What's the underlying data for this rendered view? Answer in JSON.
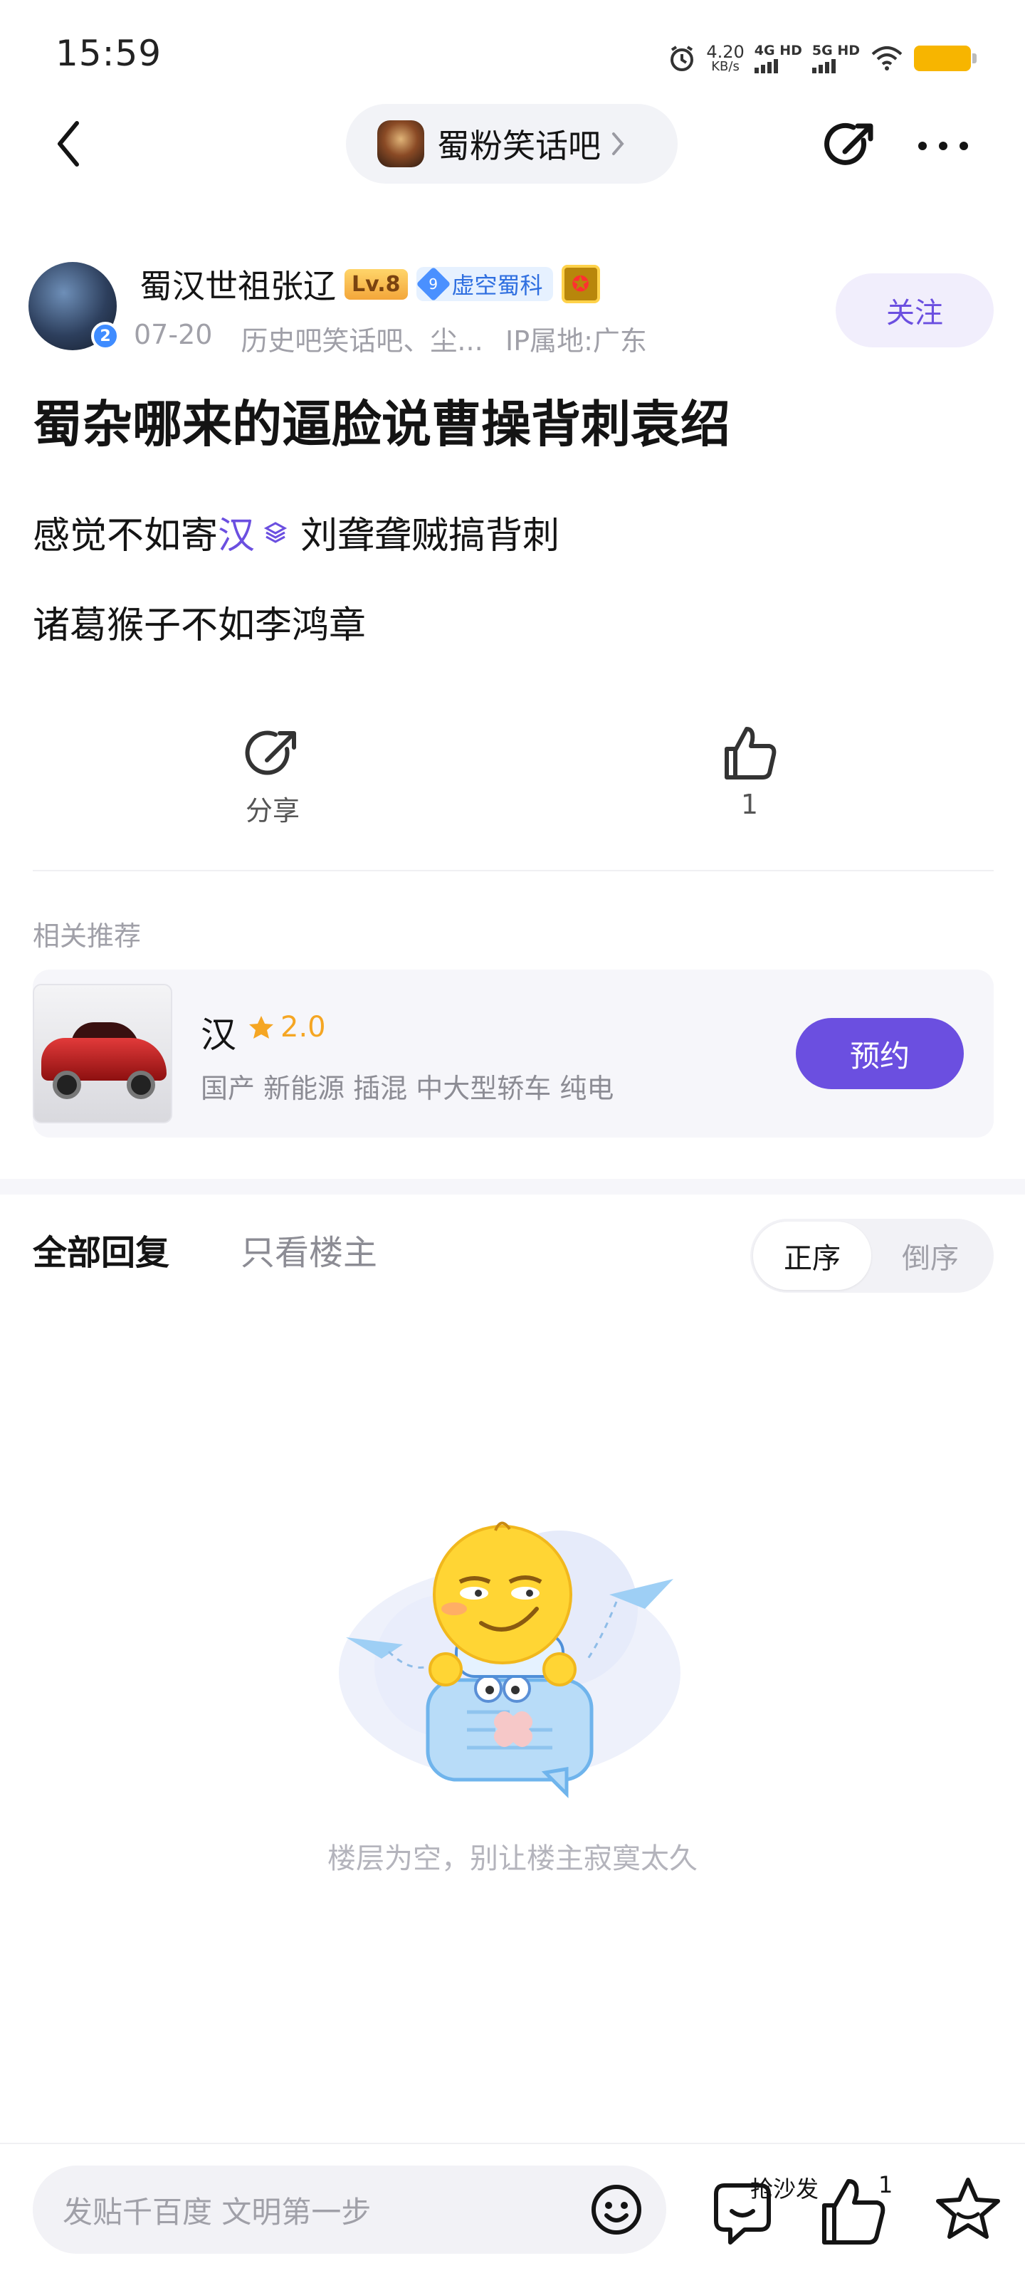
{
  "status_bar": {
    "time": "15:59",
    "net_speed_value": "4.20",
    "net_speed_unit": "KB/s",
    "sim1_label": "4G HD",
    "sim2_label": "5G HD"
  },
  "nav": {
    "forum_name": "蜀粉笑话吧"
  },
  "author": {
    "name": "蜀汉世祖张辽",
    "level": "Lv.8",
    "title_number": "9",
    "title_text": "虚空蜀科",
    "avatar_badge": "2",
    "date": "07-20",
    "forums": "历史吧笑话吧、尘...",
    "ip_location": "IP属地:广东",
    "follow_label": "关注"
  },
  "post": {
    "title": "蜀杂哪来的逼脸说曹操背刺袁绍",
    "line1_before": "感觉不如寄",
    "line1_link": "汉",
    "line1_after": "刘聋聋贼搞背刺",
    "line2": "诸葛猴子不如李鸿章"
  },
  "actions": {
    "share_label": "分享",
    "like_count": "1"
  },
  "related": {
    "section_label": "相关推荐",
    "name": "汉",
    "rating": "2.0",
    "tags": "国产 新能源 插混 中大型轿车 纯电",
    "reserve_label": "预约"
  },
  "replies": {
    "tab_all": "全部回复",
    "tab_op_only": "只看楼主",
    "sort_asc": "正序",
    "sort_desc": "倒序",
    "empty_text": "楼层为空，别让楼主寂寞太久"
  },
  "bottom_bar": {
    "input_placeholder": "发贴千百度 文明第一步",
    "sofa_label": "抢沙发",
    "like_count": "1"
  },
  "colors": {
    "accent": "#6b4fe0",
    "rating": "#f5a623"
  }
}
